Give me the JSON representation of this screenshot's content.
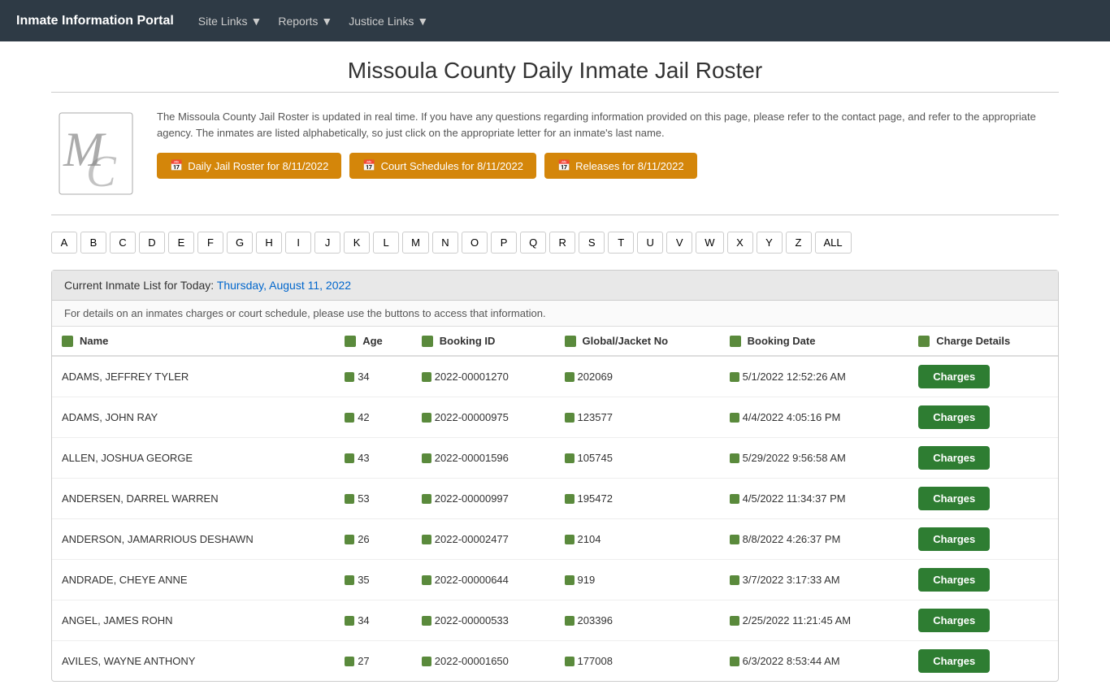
{
  "navbar": {
    "brand": "Inmate Information Portal",
    "links": [
      {
        "label": "Site Links",
        "hasDropdown": true
      },
      {
        "label": "Reports",
        "hasDropdown": true
      },
      {
        "label": "Justice Links",
        "hasDropdown": true
      }
    ]
  },
  "page": {
    "title": "Missoula County Daily Inmate Jail Roster",
    "description": "The Missoula County Jail Roster is updated in real time. If you have any questions regarding information provided on this page, please refer to the contact page, and refer to the appropriate agency. The inmates are listed alphabetically, so just click on the appropriate letter for an inmate's last name.",
    "buttons": [
      {
        "label": "Daily Jail Roster for 8/11/2022",
        "icon": "calendar"
      },
      {
        "label": "Court Schedules for 8/11/2022",
        "icon": "calendar"
      },
      {
        "label": "Releases for 8/11/2022",
        "icon": "calendar"
      }
    ]
  },
  "alphaNav": {
    "letters": [
      "A",
      "B",
      "C",
      "D",
      "E",
      "F",
      "G",
      "H",
      "I",
      "J",
      "K",
      "L",
      "M",
      "N",
      "O",
      "P",
      "Q",
      "R",
      "S",
      "T",
      "U",
      "V",
      "W",
      "X",
      "Y",
      "Z",
      "ALL"
    ]
  },
  "inmateList": {
    "headerPrefix": "Current Inmate List for Today:",
    "headerDate": "Thursday, August 11, 2022",
    "note": "For details on an inmates charges or court schedule, please use the buttons to access that information.",
    "columns": [
      "Name",
      "Age",
      "Booking ID",
      "Global/Jacket No",
      "Booking Date",
      "Charge Details"
    ],
    "rows": [
      {
        "name": "ADAMS, JEFFREY TYLER",
        "age": "34",
        "bookingId": "2022-00001270",
        "globalJacketNo": "202069",
        "bookingDate": "5/1/2022 12:52:26 AM",
        "chargeBtn": "Charges"
      },
      {
        "name": "ADAMS, JOHN RAY",
        "age": "42",
        "bookingId": "2022-00000975",
        "globalJacketNo": "123577",
        "bookingDate": "4/4/2022 4:05:16 PM",
        "chargeBtn": "Charges"
      },
      {
        "name": "ALLEN, JOSHUA GEORGE",
        "age": "43",
        "bookingId": "2022-00001596",
        "globalJacketNo": "105745",
        "bookingDate": "5/29/2022 9:56:58 AM",
        "chargeBtn": "Charges"
      },
      {
        "name": "ANDERSEN, DARREL WARREN",
        "age": "53",
        "bookingId": "2022-00000997",
        "globalJacketNo": "195472",
        "bookingDate": "4/5/2022 11:34:37 PM",
        "chargeBtn": "Charges"
      },
      {
        "name": "ANDERSON, JAMARRIOUS DESHAWN",
        "age": "26",
        "bookingId": "2022-00002477",
        "globalJacketNo": "2104",
        "bookingDate": "8/8/2022 4:26:37 PM",
        "chargeBtn": "Charges"
      },
      {
        "name": "ANDRADE, CHEYE ANNE",
        "age": "35",
        "bookingId": "2022-00000644",
        "globalJacketNo": "919",
        "bookingDate": "3/7/2022 3:17:33 AM",
        "chargeBtn": "Charges"
      },
      {
        "name": "ANGEL, JAMES ROHN",
        "age": "34",
        "bookingId": "2022-00000533",
        "globalJacketNo": "203396",
        "bookingDate": "2/25/2022 11:21:45 AM",
        "chargeBtn": "Charges"
      },
      {
        "name": "AVILES, WAYNE ANTHONY",
        "age": "27",
        "bookingId": "2022-00001650",
        "globalJacketNo": "177008",
        "bookingDate": "6/3/2022 8:53:44 AM",
        "chargeBtn": "Charges"
      }
    ]
  }
}
